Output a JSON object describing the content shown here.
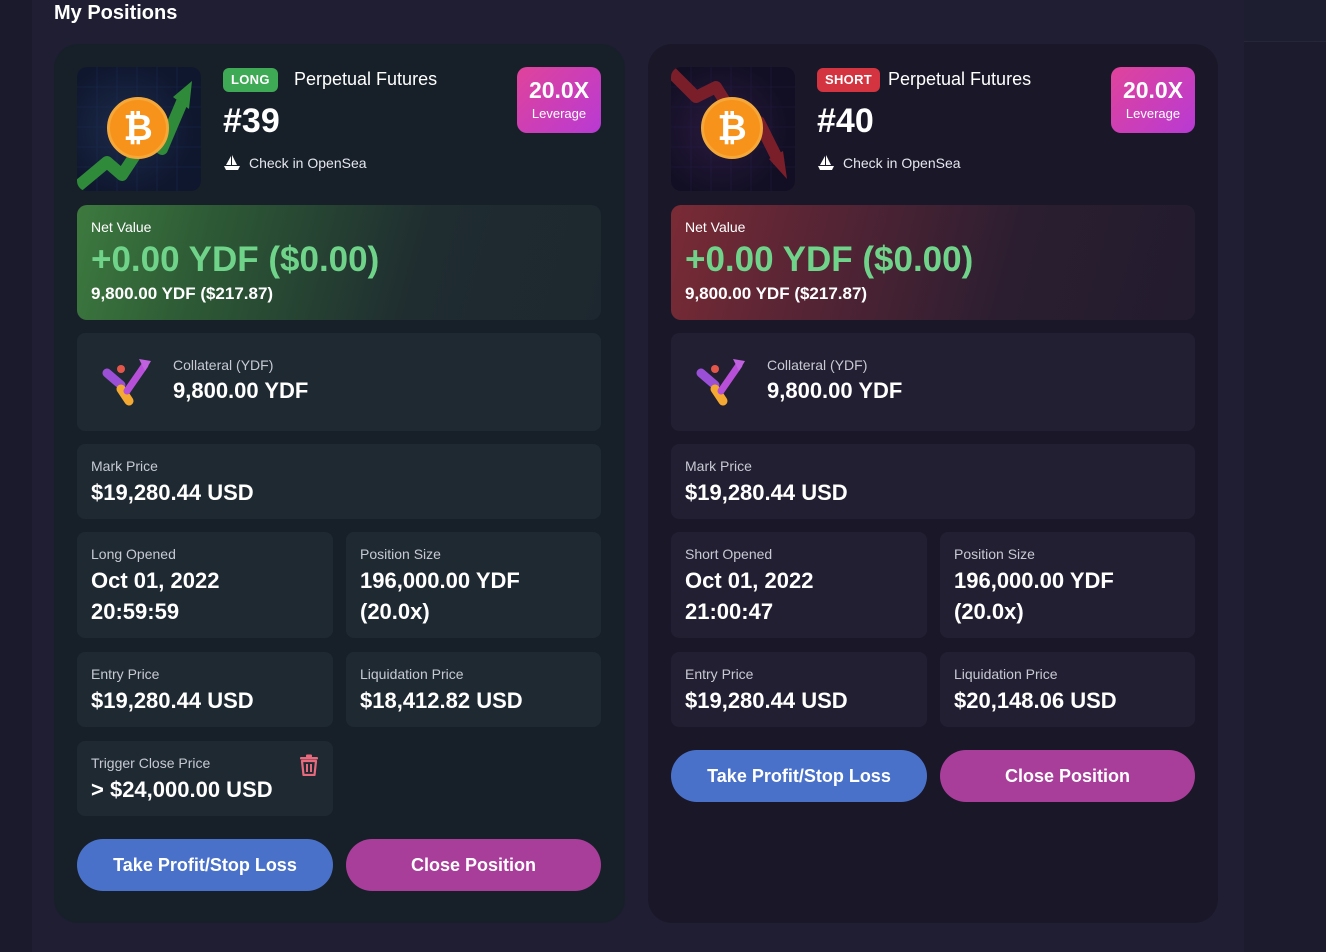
{
  "page": {
    "title": "My Positions"
  },
  "positions": [
    {
      "side": "LONG",
      "type": "Perpetual Futures",
      "id": "#39",
      "opensea": "Check in OpenSea",
      "leverage": "20.0X",
      "leverage_label": "Leverage",
      "net_label": "Net Value",
      "net_value": "+0.00 YDF ($0.00)",
      "net_sub": "9,800.00 YDF ($217.87)",
      "collateral_label": "Collateral (YDF)",
      "collateral_value": "9,800.00 YDF",
      "mark_label": "Mark Price",
      "mark_value": "$19,280.44 USD",
      "opened_label": "Long Opened",
      "opened_date": "Oct 01, 2022",
      "opened_time": "20:59:59",
      "size_label": "Position Size",
      "size_value": "196,000.00 YDF",
      "size_mult": "(20.0x)",
      "entry_label": "Entry Price",
      "entry_value": "$19,280.44 USD",
      "liq_label": "Liquidation Price",
      "liq_value": "$18,412.82 USD",
      "trigger_label": "Trigger Close Price",
      "trigger_value": "> $24,000.00 USD",
      "tp_button": "Take Profit/Stop Loss",
      "close_button": "Close Position"
    },
    {
      "side": "SHORT",
      "type": "Perpetual Futures",
      "id": "#40",
      "opensea": "Check in OpenSea",
      "leverage": "20.0X",
      "leverage_label": "Leverage",
      "net_label": "Net Value",
      "net_value": "+0.00 YDF ($0.00)",
      "net_sub": "9,800.00 YDF ($217.87)",
      "collateral_label": "Collateral (YDF)",
      "collateral_value": "9,800.00 YDF",
      "mark_label": "Mark Price",
      "mark_value": "$19,280.44 USD",
      "opened_label": "Short Opened",
      "opened_date": "Oct 01, 2022",
      "opened_time": "21:00:47",
      "size_label": "Position Size",
      "size_value": "196,000.00 YDF",
      "size_mult": "(20.0x)",
      "entry_label": "Entry Price",
      "entry_value": "$19,280.44 USD",
      "liq_label": "Liquidation Price",
      "liq_value": "$20,148.06 USD",
      "tp_button": "Take Profit/Stop Loss",
      "close_button": "Close Position"
    }
  ],
  "colors": {
    "long_badge": "#3eaa55",
    "short_badge": "#d43340",
    "net_value_text": "#6fd38a",
    "take_profit_button": "#4a71c9",
    "close_button": "#a83d9a",
    "leverage_gradient_start": "#e0439a",
    "leverage_gradient_end": "#b83ad4"
  },
  "icons": {
    "nft_symbol": "bitcoin-icon",
    "opensea": "opensea-icon",
    "collateral": "ydf-logo-icon",
    "delete": "trash-icon"
  }
}
